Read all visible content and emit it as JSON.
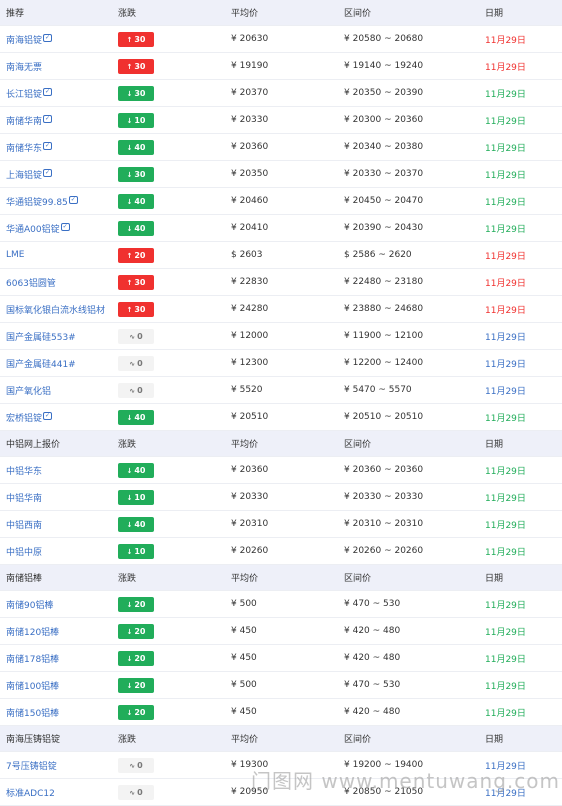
{
  "columns": {
    "change": "涨跌",
    "avg": "平均价",
    "range": "区间价",
    "date": "日期"
  },
  "colors": {
    "up": "#f0312f",
    "down": "#21ad5a",
    "flat": "#3a6fc4",
    "header_bg": "#eef0f9"
  },
  "sections": [
    {
      "title": "推荐",
      "rows": [
        {
          "name": "南海铝锭",
          "icon": true,
          "dir": "up",
          "change": "30",
          "avg": "¥ 20630",
          "range": "¥ 20580 ~ 20680",
          "date": "11月29日"
        },
        {
          "name": "南海无票",
          "icon": false,
          "dir": "up",
          "change": "30",
          "avg": "¥ 19190",
          "range": "¥ 19140 ~ 19240",
          "date": "11月29日"
        },
        {
          "name": "长江铝锭",
          "icon": true,
          "dir": "down",
          "change": "30",
          "avg": "¥ 20370",
          "range": "¥ 20350 ~ 20390",
          "date": "11月29日"
        },
        {
          "name": "南储华南",
          "icon": true,
          "dir": "down",
          "change": "10",
          "avg": "¥ 20330",
          "range": "¥ 20300 ~ 20360",
          "date": "11月29日"
        },
        {
          "name": "南储华东",
          "icon": true,
          "dir": "down",
          "change": "40",
          "avg": "¥ 20360",
          "range": "¥ 20340 ~ 20380",
          "date": "11月29日"
        },
        {
          "name": "上海铝锭",
          "icon": true,
          "dir": "down",
          "change": "30",
          "avg": "¥ 20350",
          "range": "¥ 20330 ~ 20370",
          "date": "11月29日"
        },
        {
          "name": "华通铝锭99.85",
          "icon": true,
          "dir": "down",
          "change": "40",
          "avg": "¥ 20460",
          "range": "¥ 20450 ~ 20470",
          "date": "11月29日"
        },
        {
          "name": "华通A00铝锭",
          "icon": true,
          "dir": "down",
          "change": "40",
          "avg": "¥ 20410",
          "range": "¥ 20390 ~ 20430",
          "date": "11月29日"
        },
        {
          "name": "LME",
          "icon": false,
          "dir": "up",
          "change": "20",
          "avg": "$ 2603",
          "range": "$ 2586 ~ 2620",
          "date": "11月29日"
        },
        {
          "name": "6063铝圆管",
          "icon": false,
          "dir": "up",
          "change": "30",
          "avg": "¥ 22830",
          "range": "¥ 22480 ~ 23180",
          "date": "11月29日"
        },
        {
          "name": "国标氧化银白流水线铝材",
          "icon": false,
          "dir": "up",
          "change": "30",
          "avg": "¥ 24280",
          "range": "¥ 23880 ~ 24680",
          "date": "11月29日"
        },
        {
          "name": "国产金属硅553#",
          "icon": false,
          "dir": "flat",
          "change": "0",
          "avg": "¥ 12000",
          "range": "¥ 11900 ~ 12100",
          "date": "11月29日"
        },
        {
          "name": "国产金属硅441#",
          "icon": false,
          "dir": "flat",
          "change": "0",
          "avg": "¥ 12300",
          "range": "¥ 12200 ~ 12400",
          "date": "11月29日"
        },
        {
          "name": "国产氧化铝",
          "icon": false,
          "dir": "flat",
          "change": "0",
          "avg": "¥ 5520",
          "range": "¥ 5470 ~ 5570",
          "date": "11月29日"
        },
        {
          "name": "宏桥铝锭",
          "icon": true,
          "dir": "down",
          "change": "40",
          "avg": "¥ 20510",
          "range": "¥ 20510 ~ 20510",
          "date": "11月29日"
        }
      ]
    },
    {
      "title": "中铝网上报价",
      "rows": [
        {
          "name": "中铝华东",
          "icon": false,
          "dir": "down",
          "change": "40",
          "avg": "¥ 20360",
          "range": "¥ 20360 ~ 20360",
          "date": "11月29日"
        },
        {
          "name": "中铝华南",
          "icon": false,
          "dir": "down",
          "change": "10",
          "avg": "¥ 20330",
          "range": "¥ 20330 ~ 20330",
          "date": "11月29日"
        },
        {
          "name": "中铝西南",
          "icon": false,
          "dir": "down",
          "change": "40",
          "avg": "¥ 20310",
          "range": "¥ 20310 ~ 20310",
          "date": "11月29日"
        },
        {
          "name": "中铝中原",
          "icon": false,
          "dir": "down",
          "change": "10",
          "avg": "¥ 20260",
          "range": "¥ 20260 ~ 20260",
          "date": "11月29日"
        }
      ]
    },
    {
      "title": "南储铝棒",
      "rows": [
        {
          "name": "南储90铝棒",
          "icon": false,
          "dir": "down",
          "change": "20",
          "avg": "¥ 500",
          "range": "¥ 470 ~ 530",
          "date": "11月29日"
        },
        {
          "name": "南储120铝棒",
          "icon": false,
          "dir": "down",
          "change": "20",
          "avg": "¥ 450",
          "range": "¥ 420 ~ 480",
          "date": "11月29日"
        },
        {
          "name": "南储178铝棒",
          "icon": false,
          "dir": "down",
          "change": "20",
          "avg": "¥ 450",
          "range": "¥ 420 ~ 480",
          "date": "11月29日"
        },
        {
          "name": "南储100铝棒",
          "icon": false,
          "dir": "down",
          "change": "20",
          "avg": "¥ 500",
          "range": "¥ 470 ~ 530",
          "date": "11月29日"
        },
        {
          "name": "南储150铝棒",
          "icon": false,
          "dir": "down",
          "change": "20",
          "avg": "¥ 450",
          "range": "¥ 420 ~ 480",
          "date": "11月29日"
        }
      ]
    },
    {
      "title": "南海压铸铝锭",
      "rows": [
        {
          "name": "7号压铸铝锭",
          "icon": false,
          "dir": "flat",
          "change": "0",
          "avg": "¥ 19300",
          "range": "¥ 19200 ~ 19400",
          "date": "11月29日"
        },
        {
          "name": "标准ADC12",
          "icon": false,
          "dir": "flat",
          "change": "0",
          "avg": "¥ 20950",
          "range": "¥ 20850 ~ 21050",
          "date": "11月29日"
        }
      ]
    }
  ],
  "watermark": "门图网 www.mentuwang.com"
}
